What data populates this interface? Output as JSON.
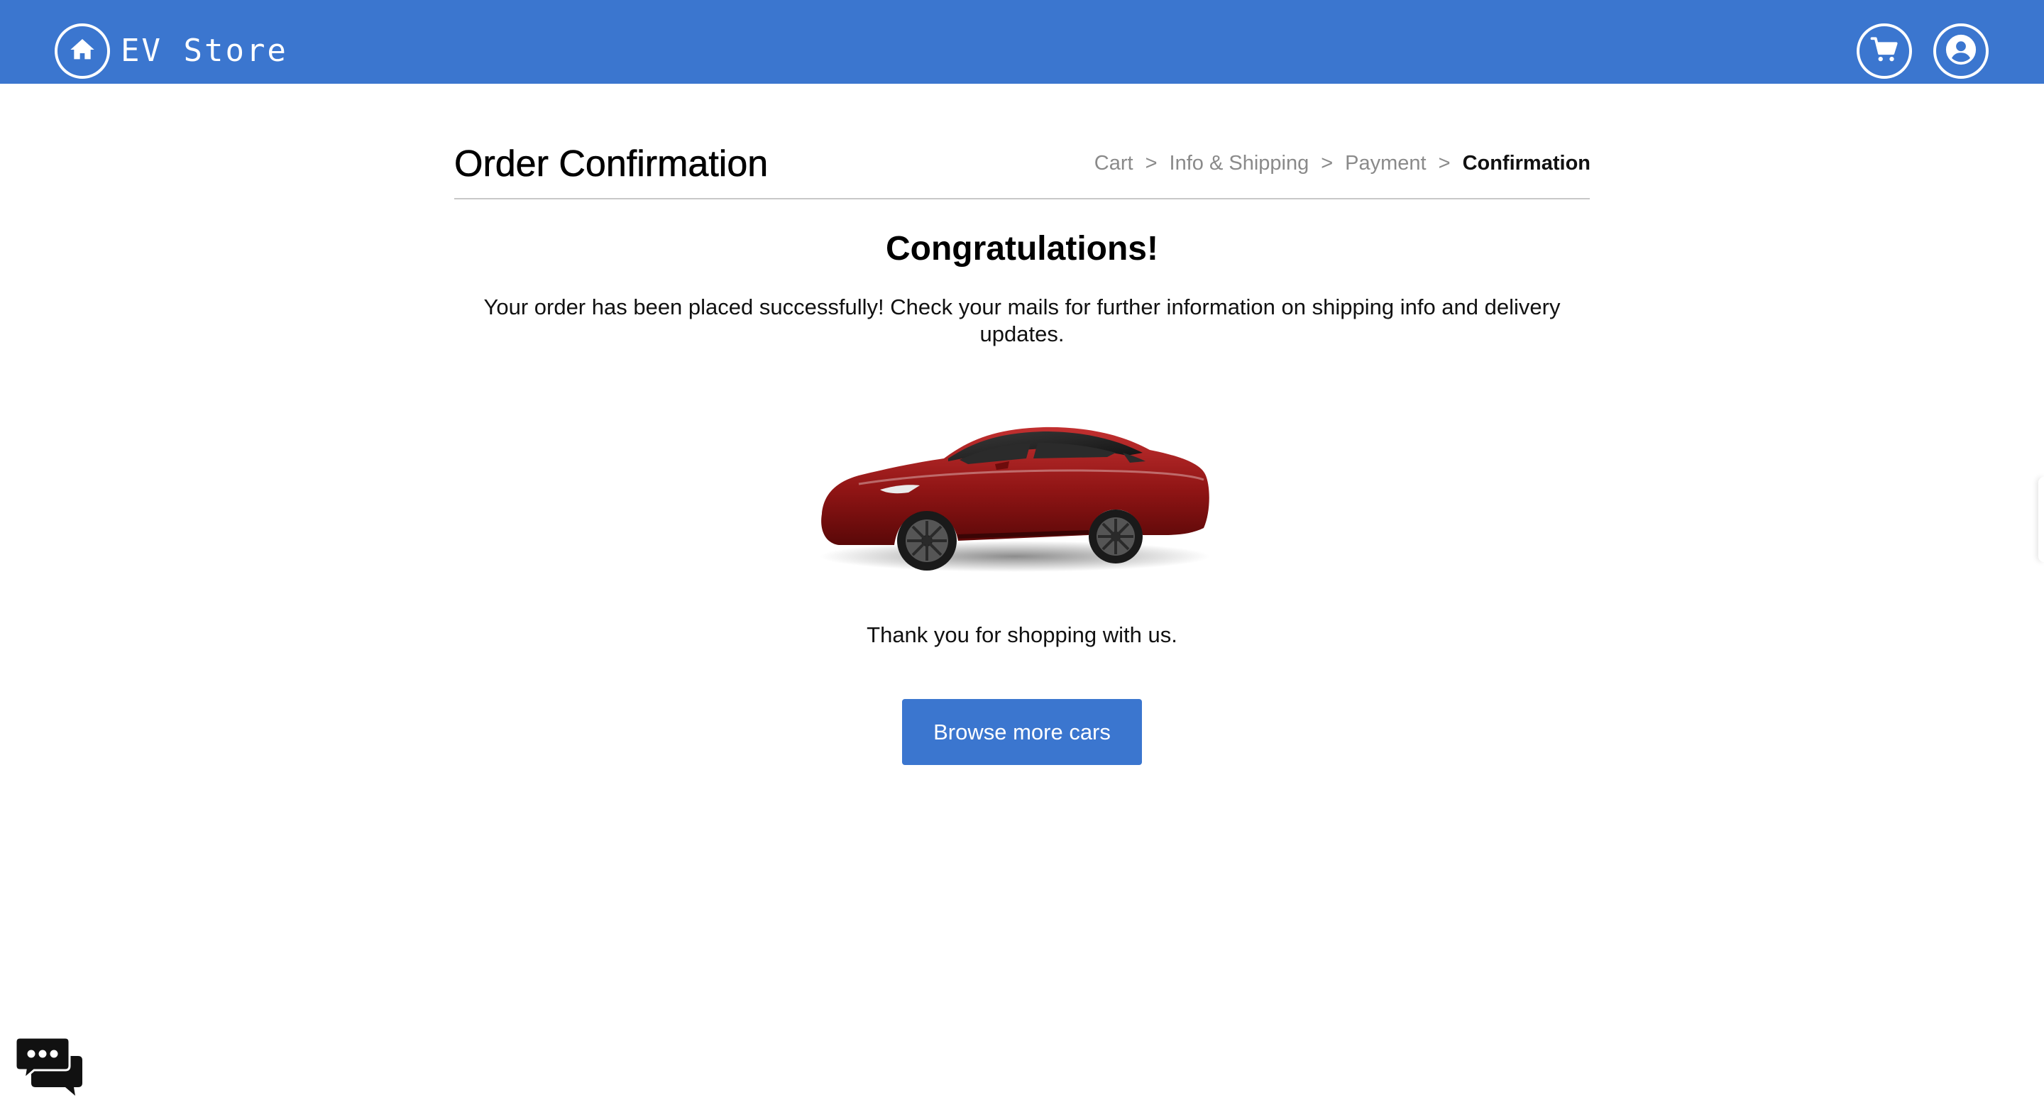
{
  "header": {
    "brand": "EV Store",
    "home_icon": "home-icon",
    "cart_icon": "cart-icon",
    "account_icon": "account-icon",
    "bar_color": "#3b76cf"
  },
  "page": {
    "title": "Order Confirmation"
  },
  "breadcrumb": {
    "items": [
      {
        "label": "Cart"
      },
      {
        "label": "Info & Shipping"
      },
      {
        "label": "Payment"
      },
      {
        "label": "Confirmation"
      }
    ],
    "separator": ">"
  },
  "confirmation": {
    "heading": "Congratulations!",
    "message": "Your order has been placed successfully! Check your mails for further information on shipping info and delivery updates.",
    "thanks": "Thank you for shopping with us.",
    "button_label": "Browse more cars",
    "car_color": "#9b1b1b"
  },
  "chat": {
    "icon": "chat-icon"
  }
}
